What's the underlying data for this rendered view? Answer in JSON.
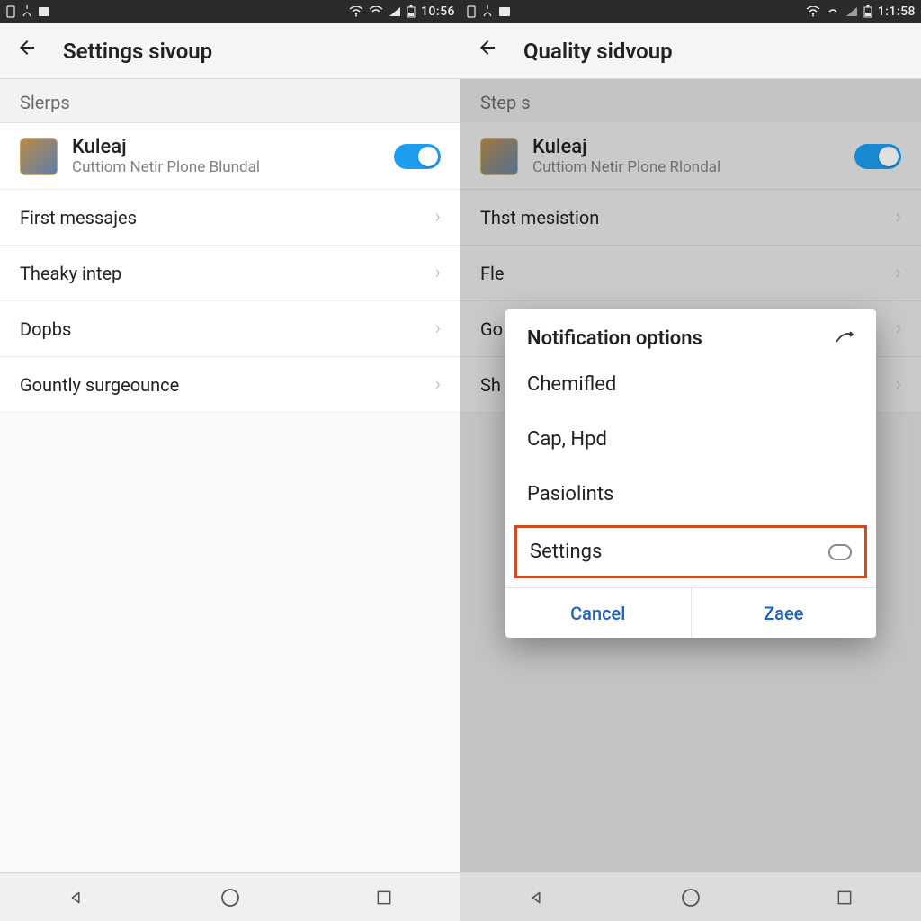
{
  "left": {
    "statusbar": {
      "time": "10:56"
    },
    "appbar": {
      "title": "Settings sivoup"
    },
    "section_header": "Slerps",
    "account": {
      "name": "Kuleaj",
      "subtitle": "Cuttiom Netir Plone Blundal"
    },
    "items": [
      {
        "label": "First messajes"
      },
      {
        "label": "Theaky intep"
      },
      {
        "label": "Dopbs"
      },
      {
        "label": "Gountly surgeounce"
      }
    ]
  },
  "right": {
    "statusbar": {
      "time": "1:1:58"
    },
    "appbar": {
      "title": "Quality sidvoup"
    },
    "section_header": "Step s",
    "account": {
      "name": "Kuleaj",
      "subtitle": "Cuttiom Netir Plone Rlondal"
    },
    "items": [
      {
        "label": "Thst mesistion"
      },
      {
        "label": "Fle"
      },
      {
        "label": "Go"
      },
      {
        "label": "Sh"
      }
    ],
    "dialog": {
      "title": "Notification options",
      "options": [
        {
          "label": "Chemifled"
        },
        {
          "label": "Cap, Hpd"
        },
        {
          "label": "Pasiolints"
        },
        {
          "label": "Settings"
        }
      ],
      "cancel": "Cancel",
      "confirm": "Zaee"
    }
  }
}
